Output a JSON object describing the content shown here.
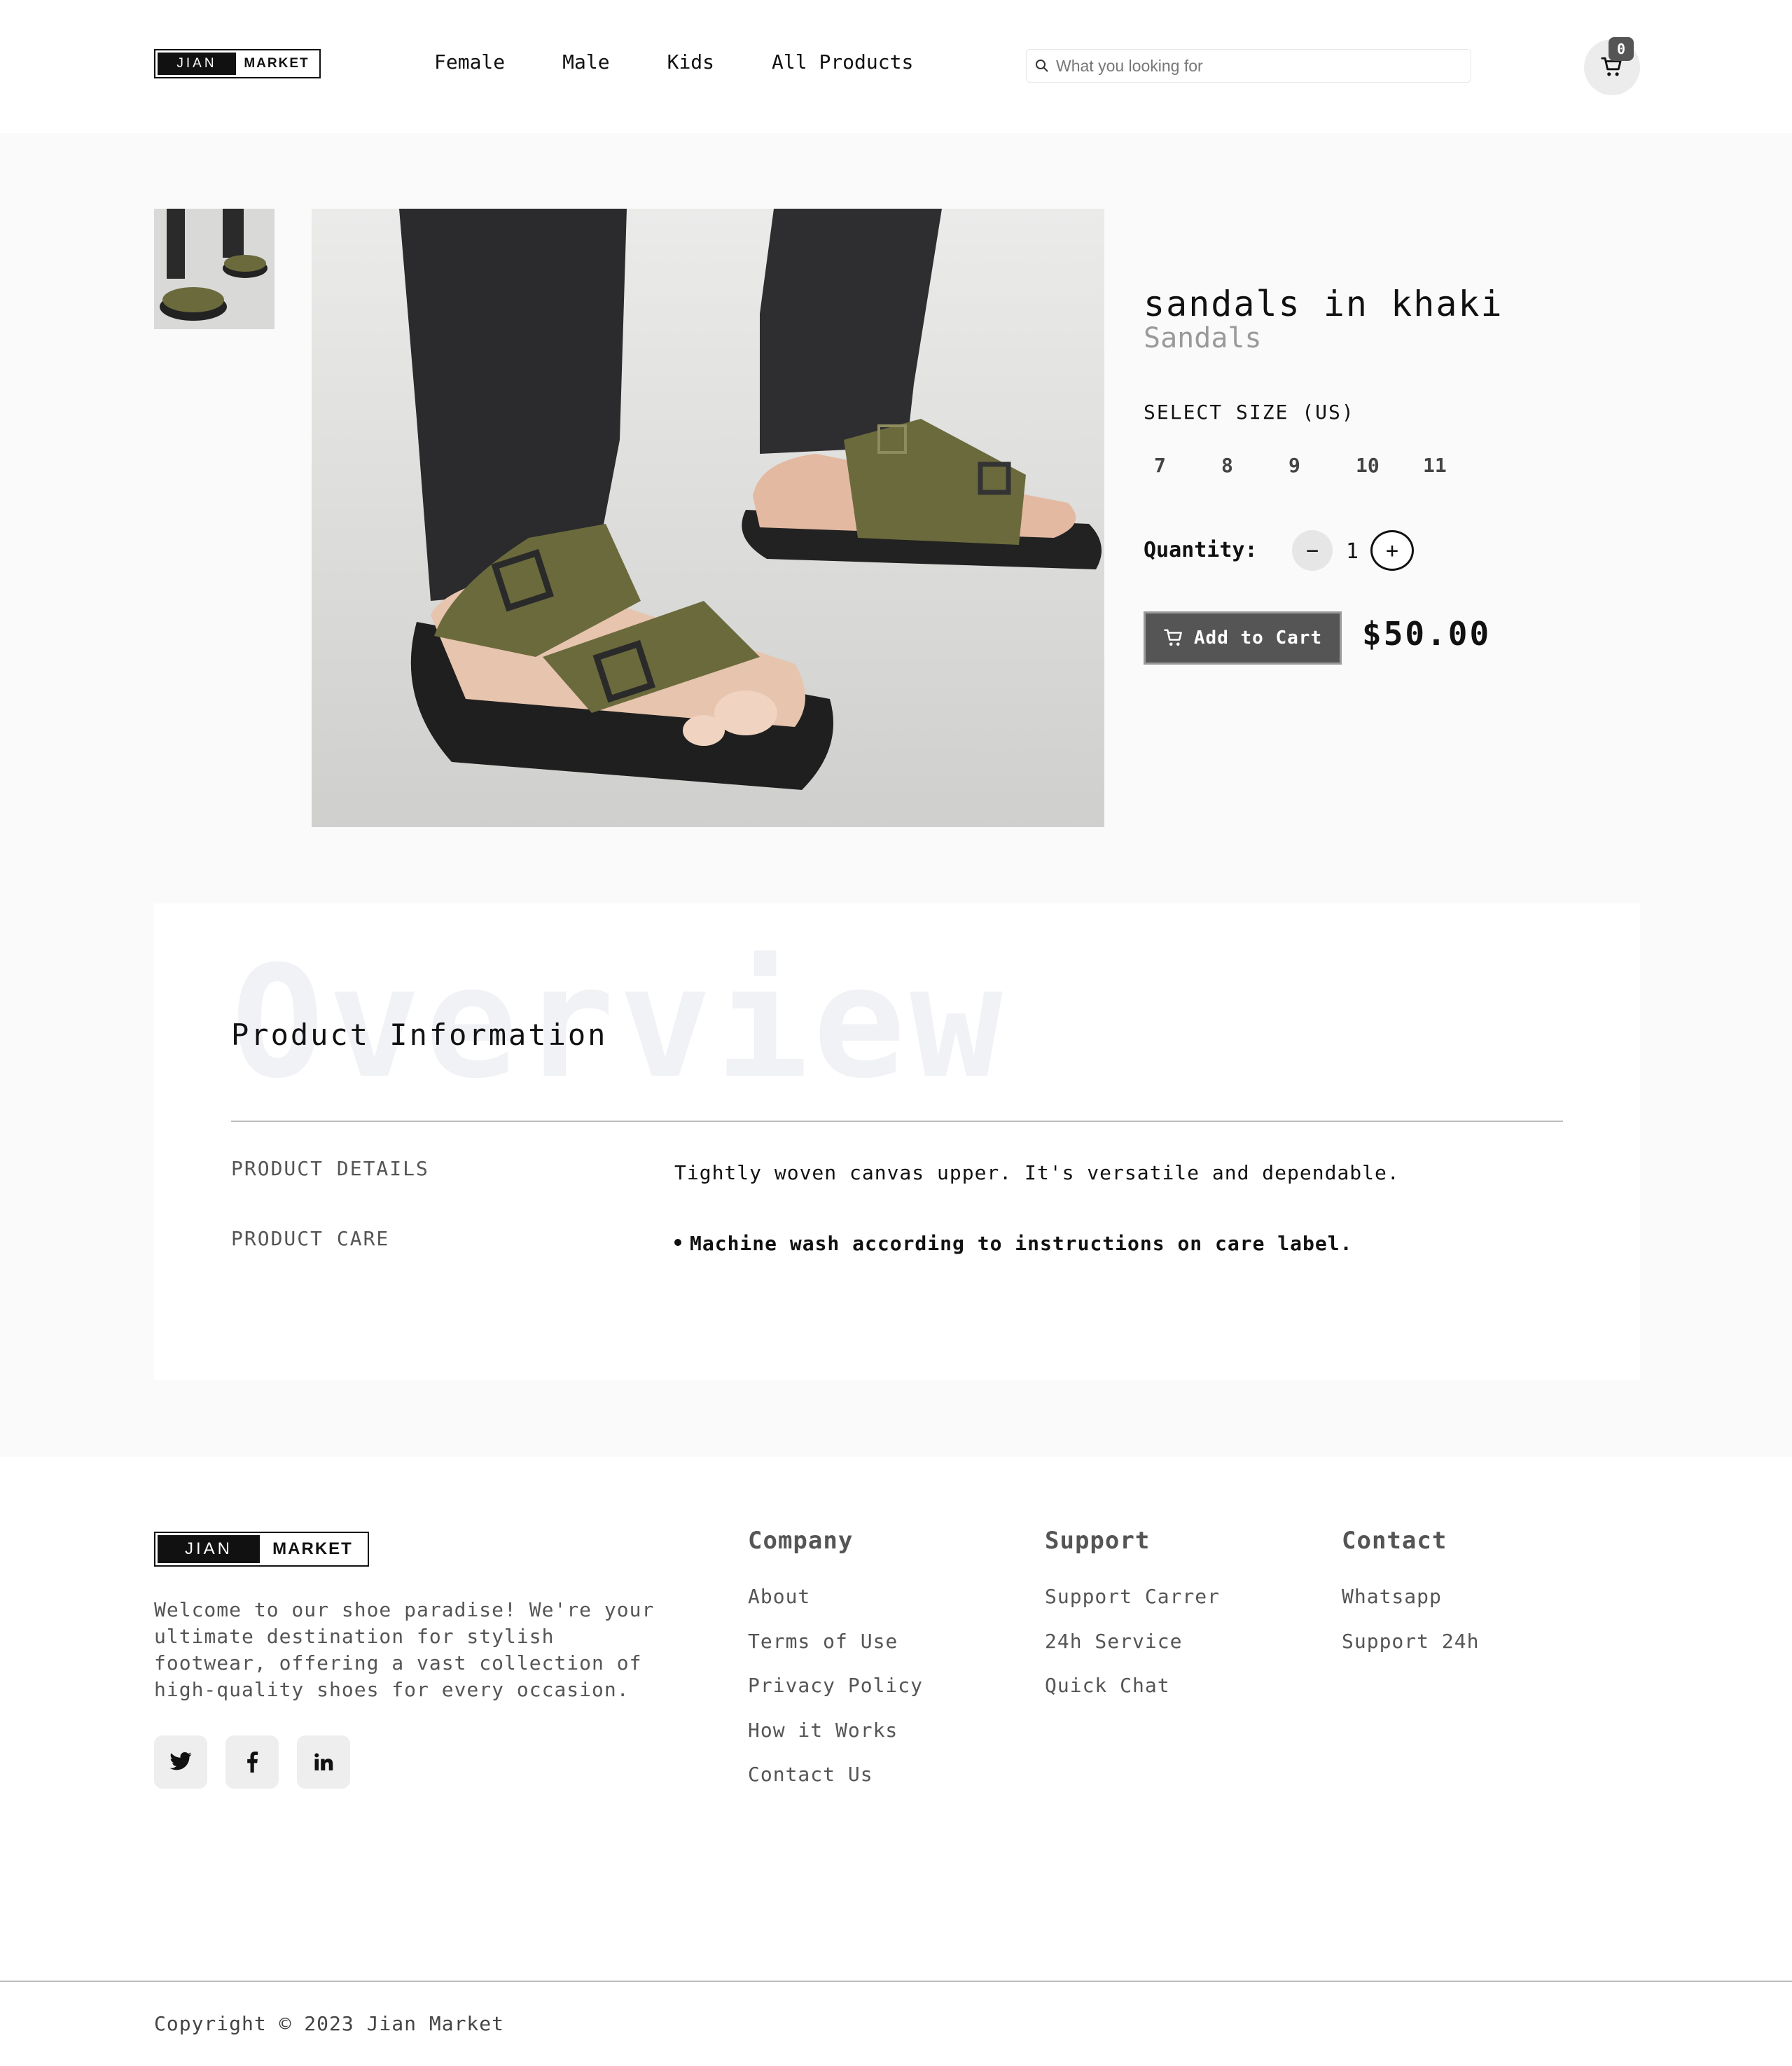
{
  "header": {
    "logo": {
      "left": "JIAN",
      "right": "MARKET"
    },
    "nav": [
      "Female",
      "Male",
      "Kids",
      "All Products"
    ],
    "search_placeholder": "What you looking for",
    "cart_count": "0"
  },
  "product": {
    "title": "sandals in khaki",
    "category": "Sandals",
    "size_label": "SELECT SIZE (US)",
    "sizes": [
      "7",
      "8",
      "9",
      "10",
      "11"
    ],
    "quantity_label": "Quantity:",
    "quantity_minus": "−",
    "quantity_value": "1",
    "quantity_plus": "+",
    "add_to_cart": "Add to Cart",
    "price": "$50.00"
  },
  "overview": {
    "watermark": "Overview",
    "title": "Product Information",
    "rows": [
      {
        "label": "PRODUCT DETAILS",
        "text": "Tightly woven canvas upper. It's versatile and dependable."
      },
      {
        "label": "PRODUCT CARE",
        "text": "Machine wash according to instructions on care label."
      }
    ]
  },
  "footer": {
    "about": "Welcome to our shoe paradise! We're your ultimate destination for stylish footwear, offering a vast collection of high-quality shoes for every occasion.",
    "social": [
      "twitter-icon",
      "facebook-icon",
      "linkedin-icon"
    ],
    "columns": [
      {
        "title": "Company",
        "links": [
          "About",
          "Terms of Use",
          "Privacy Policy",
          "How it Works",
          "Contact Us"
        ]
      },
      {
        "title": "Support",
        "links": [
          "Support Carrer",
          "24h Service",
          "Quick Chat"
        ]
      },
      {
        "title": "Contact",
        "links": [
          "Whatsapp",
          "Support 24h"
        ]
      }
    ],
    "copyright": "Copyright © 2023 Jian Market"
  },
  "colors": {
    "primary_dark": "#555555",
    "page_bg": "#fafafa",
    "sandal_khaki": "#6b6a3c"
  }
}
